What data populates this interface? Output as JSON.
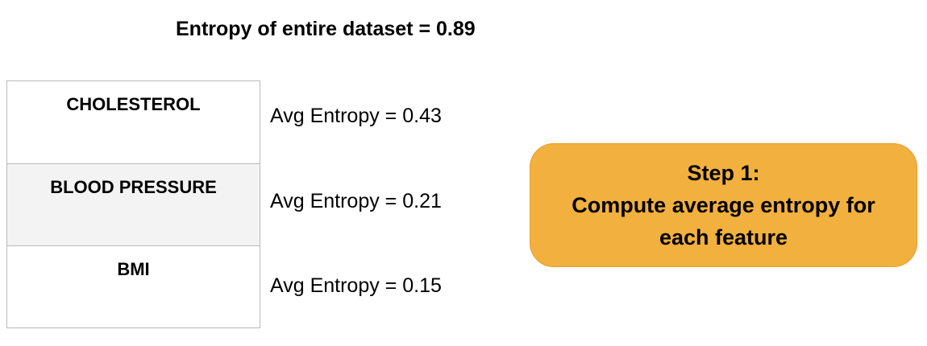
{
  "title": "Entropy of entire dataset = 0.89",
  "features": [
    {
      "name": "CHOLESTEROL",
      "avg_entropy_text": "Avg Entropy = 0.43",
      "avg_entropy": 0.43
    },
    {
      "name": "BLOOD PRESSURE",
      "avg_entropy_text": "Avg Entropy = 0.21",
      "avg_entropy": 0.21
    },
    {
      "name": "BMI",
      "avg_entropy_text": "Avg Entropy = 0.15",
      "avg_entropy": 0.15
    }
  ],
  "callout": {
    "line1": "Step 1:",
    "line2": "Compute average entropy for",
    "line3": "each feature"
  },
  "colors": {
    "callout_fill": "#f2b03e",
    "table_border": "#b9b9b9",
    "alt_row_fill": "#f3f3f3"
  }
}
